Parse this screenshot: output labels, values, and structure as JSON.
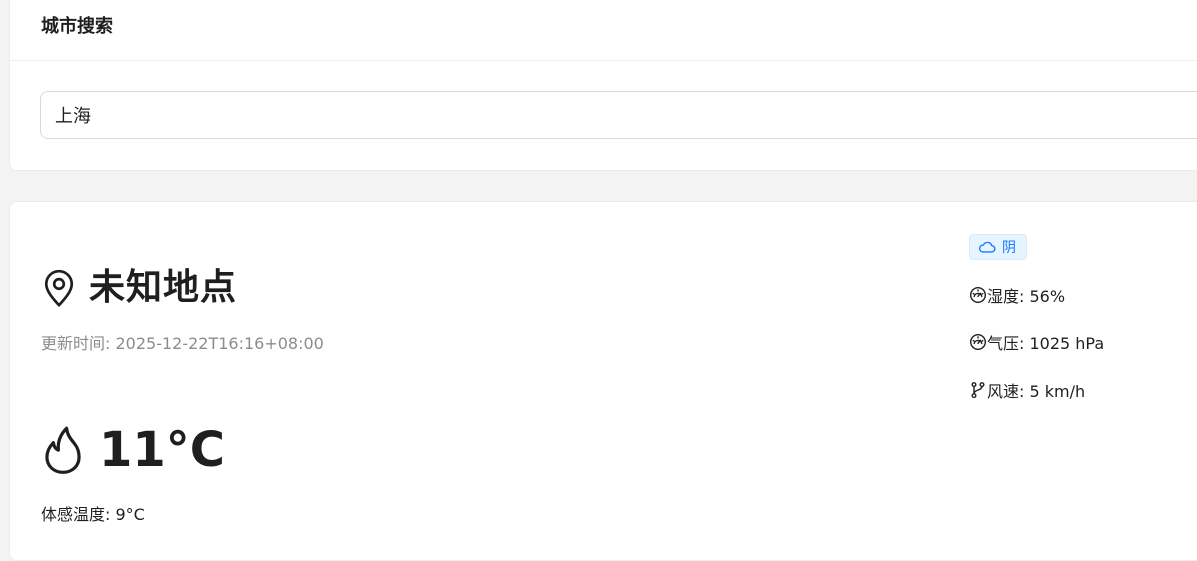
{
  "search": {
    "title": "城市搜索",
    "input_value": "上海"
  },
  "weather": {
    "location": "未知地点",
    "updated": "更新时间: 2025-12-22T16:16+08:00",
    "temperature": "11°C",
    "feels_like": "体感温度: 9°C",
    "condition": "阴",
    "humidity": "湿度: 56%",
    "pressure": "气压: 1025 hPa",
    "wind": "风速: 5 km/h"
  },
  "icons": {
    "location": "map-pin-icon",
    "temperature": "flame-icon",
    "condition": "cloud-icon",
    "humidity": "dashboard-icon",
    "pressure": "dashboard-icon",
    "wind": "branch-icon"
  },
  "colors": {
    "tag_background": "#e6f4ff",
    "tag_text": "#1677ff",
    "muted_text": "#8c8c8c"
  }
}
